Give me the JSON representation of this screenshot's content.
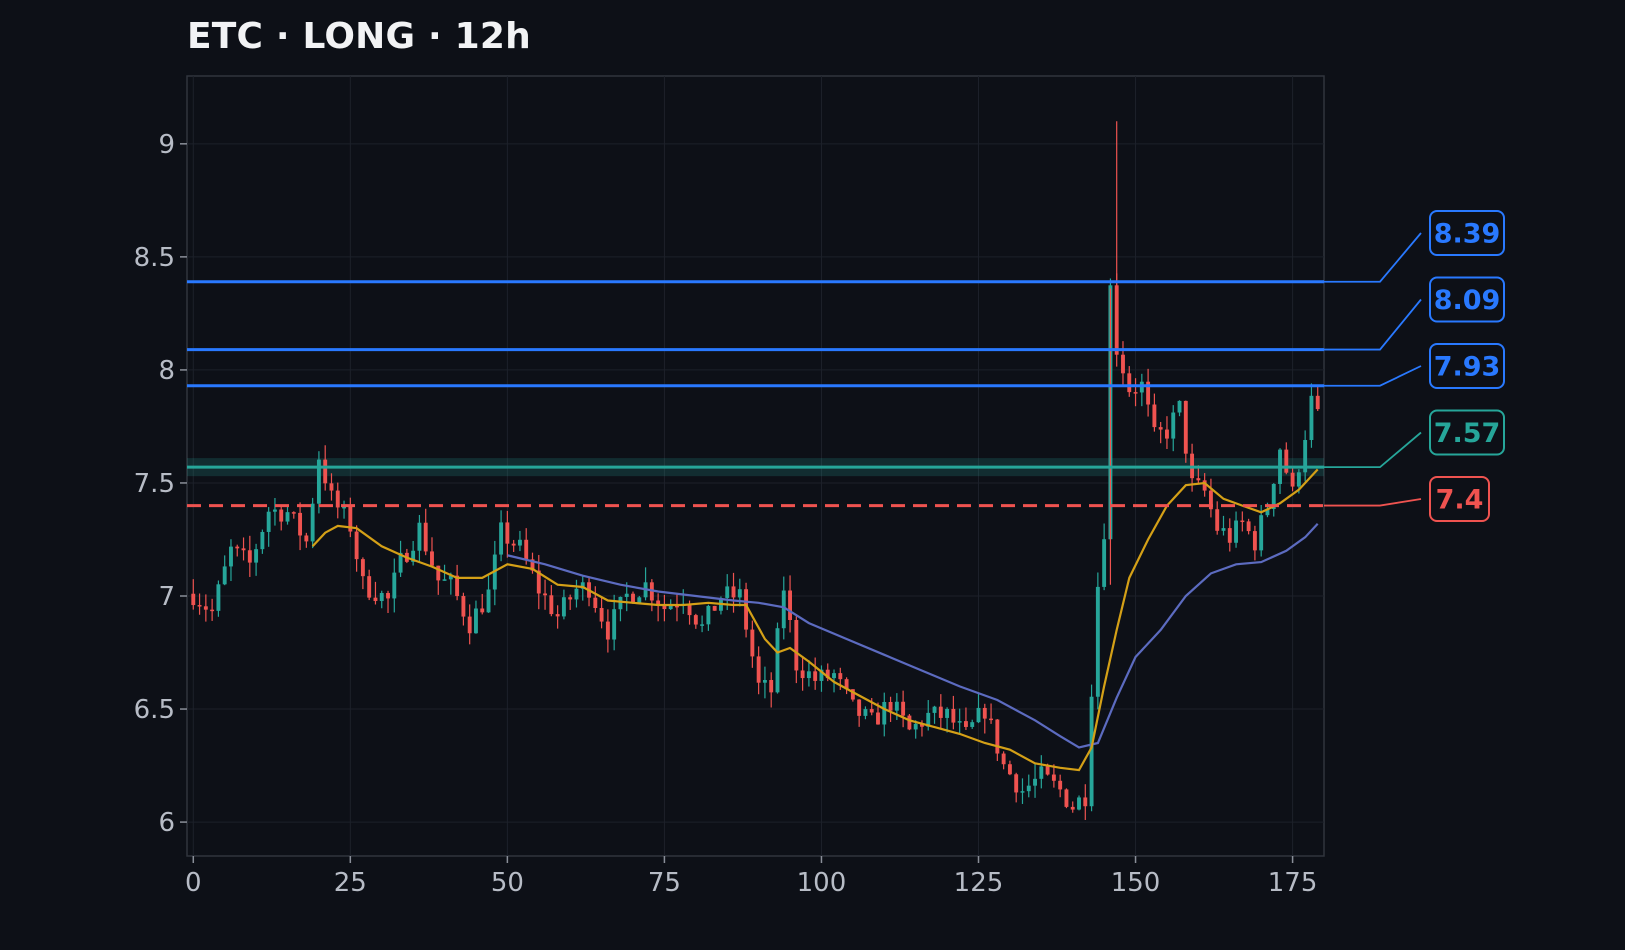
{
  "title": "ETC · LONG · 12h",
  "chart_data": {
    "type": "candlestick",
    "title": "ETC · LONG · 12h",
    "xlim": [
      -1,
      180
    ],
    "ylim": [
      5.85,
      9.3
    ],
    "x_ticks": [
      0,
      25,
      50,
      75,
      100,
      125,
      150,
      175
    ],
    "y_ticks": [
      6,
      6.5,
      7,
      7.5,
      8,
      8.5,
      9
    ],
    "y_tick_labels": [
      "6",
      "6.5",
      "7",
      "7.5",
      "8",
      "8.5",
      "9"
    ],
    "grid": true,
    "colors": {
      "background": "#0d1017",
      "up": "#26a69a",
      "down": "#ef5350",
      "ma_fast": "#d4a017",
      "ma_slow": "#5c6bc0",
      "target": "#2979ff",
      "entry": "#26a69a",
      "stop": "#ef5350"
    },
    "close_path": [
      [
        0,
        7.01
      ],
      [
        3,
        6.93
      ],
      [
        6,
        7.2
      ],
      [
        9,
        7.14
      ],
      [
        12,
        7.38
      ],
      [
        15,
        7.37
      ],
      [
        18,
        7.24
      ],
      [
        20,
        7.62
      ],
      [
        22,
        7.43
      ],
      [
        25,
        7.31
      ],
      [
        27,
        7.05
      ],
      [
        29,
        7.02
      ],
      [
        31,
        6.98
      ],
      [
        33,
        7.15
      ],
      [
        36,
        7.3
      ],
      [
        39,
        7.07
      ],
      [
        41,
        7.05
      ],
      [
        44,
        6.88
      ],
      [
        47,
        7.01
      ],
      [
        49,
        7.28
      ],
      [
        52,
        7.21
      ],
      [
        55,
        7.03
      ],
      [
        58,
        6.91
      ],
      [
        61,
        7.03
      ],
      [
        63,
        7.04
      ],
      [
        66,
        6.85
      ],
      [
        69,
        7.0
      ],
      [
        72,
        7.05
      ],
      [
        75,
        6.95
      ],
      [
        78,
        7.0
      ],
      [
        81,
        6.86
      ],
      [
        84,
        7.0
      ],
      [
        87,
        7.0
      ],
      [
        90,
        6.6
      ],
      [
        92,
        6.58
      ],
      [
        94,
        7.04
      ],
      [
        96,
        6.7
      ],
      [
        99,
        6.63
      ],
      [
        102,
        6.65
      ],
      [
        105,
        6.5
      ],
      [
        108,
        6.44
      ],
      [
        111,
        6.53
      ],
      [
        114,
        6.4
      ],
      [
        117,
        6.47
      ],
      [
        120,
        6.47
      ],
      [
        123,
        6.38
      ],
      [
        126,
        6.5
      ],
      [
        129,
        6.25
      ],
      [
        132,
        6.14
      ],
      [
        135,
        6.2
      ],
      [
        138,
        6.14
      ],
      [
        140,
        6.07
      ],
      [
        142,
        6.12
      ],
      [
        143,
        6.6
      ],
      [
        144,
        7.05
      ],
      [
        145,
        7.3
      ],
      [
        146,
        8.36
      ],
      [
        147,
        8.1
      ],
      [
        149,
        7.92
      ],
      [
        151,
        7.93
      ],
      [
        153,
        7.7
      ],
      [
        155,
        7.73
      ],
      [
        157,
        7.83
      ],
      [
        159,
        7.49
      ],
      [
        161,
        7.46
      ],
      [
        163,
        7.3
      ],
      [
        165,
        7.26
      ],
      [
        167,
        7.32
      ],
      [
        169,
        7.24
      ],
      [
        171,
        7.4
      ],
      [
        173,
        7.66
      ],
      [
        175,
        7.45
      ],
      [
        177,
        7.72
      ],
      [
        178,
        7.86
      ],
      [
        179,
        7.79
      ]
    ],
    "ma_fast": [
      [
        19,
        7.22
      ],
      [
        21,
        7.28
      ],
      [
        23,
        7.31
      ],
      [
        26,
        7.3
      ],
      [
        30,
        7.22
      ],
      [
        34,
        7.17
      ],
      [
        38,
        7.13
      ],
      [
        42,
        7.08
      ],
      [
        46,
        7.08
      ],
      [
        50,
        7.14
      ],
      [
        54,
        7.12
      ],
      [
        58,
        7.05
      ],
      [
        62,
        7.04
      ],
      [
        66,
        6.98
      ],
      [
        70,
        6.97
      ],
      [
        74,
        6.96
      ],
      [
        78,
        6.96
      ],
      [
        82,
        6.97
      ],
      [
        86,
        6.96
      ],
      [
        88,
        6.96
      ],
      [
        91,
        6.81
      ],
      [
        93,
        6.75
      ],
      [
        95,
        6.77
      ],
      [
        98,
        6.71
      ],
      [
        102,
        6.62
      ],
      [
        106,
        6.56
      ],
      [
        110,
        6.5
      ],
      [
        114,
        6.45
      ],
      [
        118,
        6.42
      ],
      [
        122,
        6.39
      ],
      [
        126,
        6.35
      ],
      [
        130,
        6.32
      ],
      [
        134,
        6.26
      ],
      [
        138,
        6.24
      ],
      [
        141,
        6.23
      ],
      [
        143,
        6.33
      ],
      [
        145,
        6.6
      ],
      [
        147,
        6.85
      ],
      [
        149,
        7.08
      ],
      [
        152,
        7.25
      ],
      [
        155,
        7.4
      ],
      [
        158,
        7.49
      ],
      [
        161,
        7.5
      ],
      [
        164,
        7.43
      ],
      [
        167,
        7.4
      ],
      [
        170,
        7.37
      ],
      [
        173,
        7.41
      ],
      [
        176,
        7.47
      ],
      [
        179,
        7.56
      ]
    ],
    "ma_slow": [
      [
        50,
        7.18
      ],
      [
        56,
        7.14
      ],
      [
        62,
        7.09
      ],
      [
        68,
        7.05
      ],
      [
        74,
        7.02
      ],
      [
        80,
        7.0
      ],
      [
        86,
        6.98
      ],
      [
        90,
        6.97
      ],
      [
        94,
        6.95
      ],
      [
        98,
        6.88
      ],
      [
        104,
        6.81
      ],
      [
        110,
        6.74
      ],
      [
        116,
        6.67
      ],
      [
        122,
        6.6
      ],
      [
        128,
        6.54
      ],
      [
        134,
        6.45
      ],
      [
        138,
        6.38
      ],
      [
        141,
        6.33
      ],
      [
        144,
        6.35
      ],
      [
        147,
        6.55
      ],
      [
        150,
        6.73
      ],
      [
        154,
        6.85
      ],
      [
        158,
        7.0
      ],
      [
        162,
        7.1
      ],
      [
        166,
        7.14
      ],
      [
        170,
        7.15
      ],
      [
        174,
        7.2
      ],
      [
        177,
        7.26
      ],
      [
        179,
        7.32
      ]
    ],
    "wick_spikes": [
      [
        147,
        9.1
      ],
      [
        146,
        7.05
      ]
    ],
    "levels": [
      {
        "value": 8.39,
        "label": "8.39",
        "kind": "target",
        "style": "solid"
      },
      {
        "value": 8.09,
        "label": "8.09",
        "kind": "target",
        "style": "solid"
      },
      {
        "value": 7.93,
        "label": "7.93",
        "kind": "target",
        "style": "solid"
      },
      {
        "value": 7.57,
        "label": "7.57",
        "kind": "entry",
        "style": "solid",
        "band": [
          7.53,
          7.61
        ]
      },
      {
        "value": 7.4,
        "label": "7.4",
        "kind": "stop",
        "style": "dashed"
      }
    ]
  }
}
